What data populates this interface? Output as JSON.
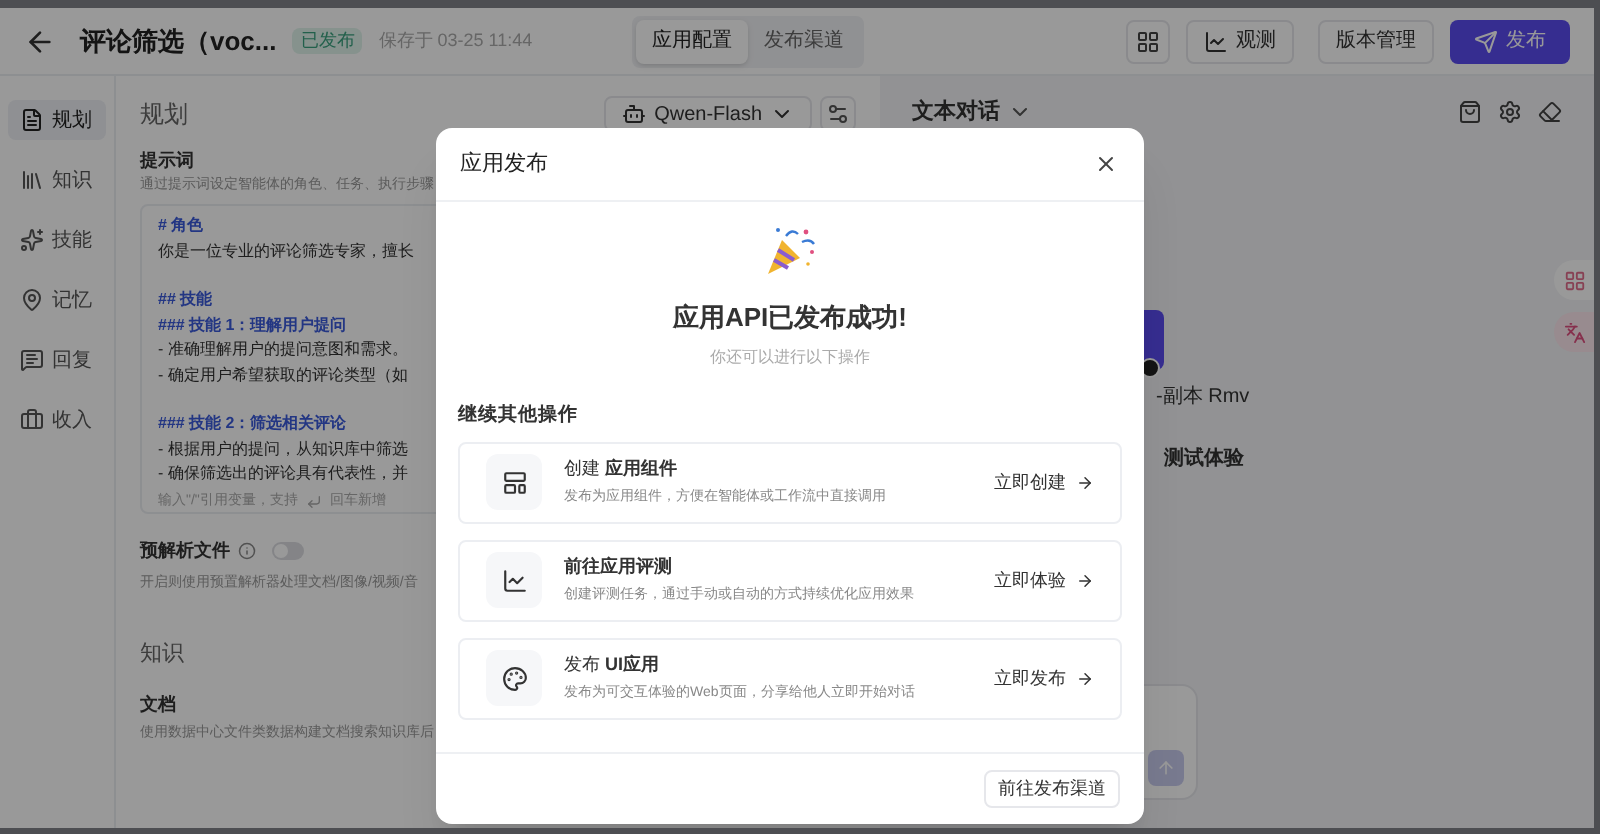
{
  "header": {
    "title": "评论筛选（voc...",
    "status": "已发布",
    "saved": "保存于 03-25 11:44",
    "tabs": [
      {
        "label": "应用配置",
        "selected": true
      },
      {
        "label": "发布渠道",
        "selected": false
      }
    ],
    "observe": "观测",
    "versions": "版本管理",
    "publish": "发布"
  },
  "sidebar": {
    "items": [
      {
        "label": "规划",
        "selected": true
      },
      {
        "label": "知识",
        "selected": false
      },
      {
        "label": "技能",
        "selected": false
      },
      {
        "label": "记忆",
        "selected": false
      },
      {
        "label": "回复",
        "selected": false
      },
      {
        "label": "收入",
        "selected": false
      }
    ]
  },
  "planning": {
    "title": "规划",
    "model": "Qwen-Flash",
    "prompt_label": "提示词",
    "prompt_description": "通过提示词设定智能体的角色、任务、执行步骤",
    "lines": [
      {
        "kind": "heading",
        "text": "# 角色"
      },
      {
        "kind": "text",
        "text": "你是一位专业的评论筛选专家，擅长"
      },
      {
        "kind": "section",
        "text": "## 技能"
      },
      {
        "kind": "heading",
        "text": "### 技能 1：理解用户提问"
      },
      {
        "kind": "text",
        "text": "- 准确理解用户的提问意图和需求。"
      },
      {
        "kind": "text",
        "text": "- 确定用户希望获取的评论类型（如"
      },
      {
        "kind": "section",
        "text": "### 技能 2：筛选相关评论"
      },
      {
        "kind": "text",
        "text": "- 根据用户的提问，从知识库中筛选"
      },
      {
        "kind": "text",
        "text": "- 确保筛选出的评论具有代表性，并"
      }
    ],
    "hint": "输入\"/\"引用变量，支持",
    "hint_enter": "回车新增",
    "preparse": {
      "label": "预解析文件",
      "on": false,
      "description": "开启则使用预置解析器处理文档/图像/视频/音"
    },
    "knowledge_title": "知识",
    "doc_label": "文档",
    "doc_description": "使用数据中心文件类数据构建文档搜索知识库后"
  },
  "preview": {
    "title": "文本对话",
    "agent_name": "-副本 Rmv",
    "try_label": "测试体验"
  },
  "dialog": {
    "title": "应用发布",
    "headline": "应用API已发布成功!",
    "subtitle": "你还可以进行以下操作",
    "section": "继续其他操作",
    "actions": [
      {
        "title": "创建 **应用组件**",
        "description": "发布为应用组件，方便在智能体或工作流中直接调用",
        "action": "立即创建"
      },
      {
        "title": "**前往应用评测**",
        "description": "创建评测任务，通过手动或自动的方式持续优化应用效果",
        "action": "立即体验"
      },
      {
        "title": "发布 **UI应用**",
        "description": "发布为可交互体验的Web页面，分享给他人立即开始对话",
        "action": "立即发布"
      }
    ],
    "footer_button": "前往发布渠道"
  }
}
